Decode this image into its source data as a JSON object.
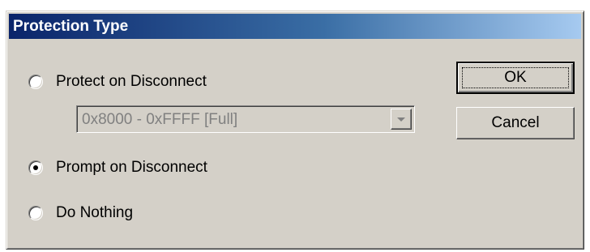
{
  "dialog": {
    "title": "Protection Type",
    "options": [
      {
        "label": "Protect on Disconnect",
        "checked": false
      },
      {
        "label": "Prompt on Disconnect",
        "checked": true
      },
      {
        "label": "Do Nothing",
        "checked": false
      }
    ],
    "range_select": {
      "value": "0x8000 - 0xFFFF [Full]",
      "disabled": true
    },
    "buttons": {
      "ok_label": "OK",
      "cancel_label": "Cancel"
    }
  },
  "colors": {
    "face": "#d4d0c8",
    "title_start": "#0a246a",
    "title_end": "#a6caf0",
    "disabled_text": "#808080"
  }
}
